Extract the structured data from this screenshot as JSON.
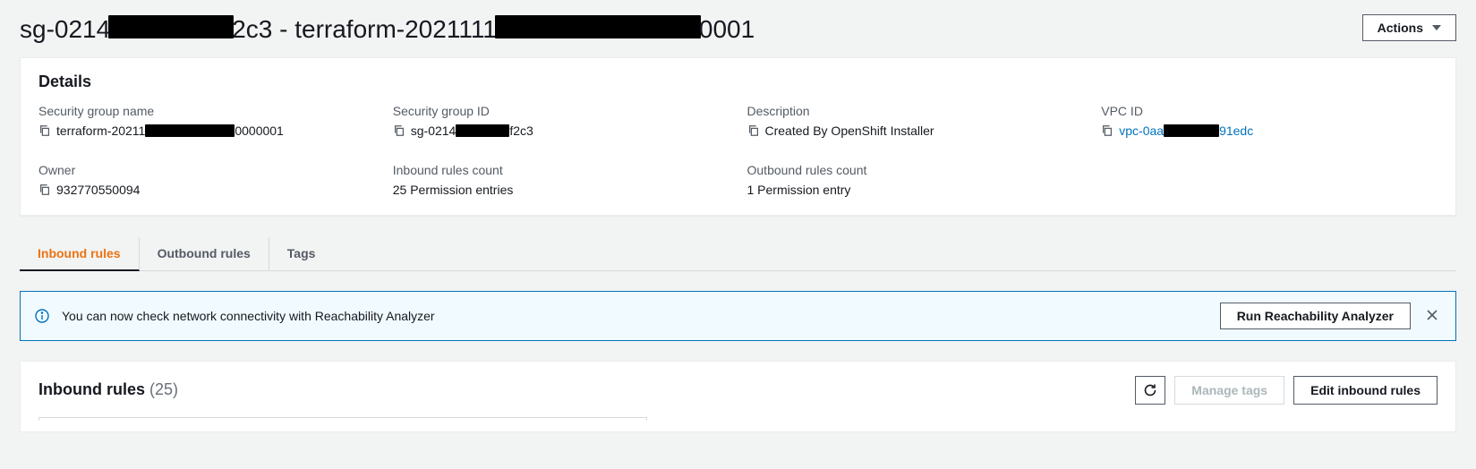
{
  "page": {
    "title_pre": "sg-0214",
    "title_mid": "2c3 - terraform-2021111",
    "title_post": "0001",
    "actions_label": "Actions"
  },
  "details": {
    "header": "Details",
    "fields": {
      "sg_name": {
        "label": "Security group name",
        "value_pre": "terraform-20211",
        "value_post": "0000001"
      },
      "sg_id": {
        "label": "Security group ID",
        "value_pre": "sg-0214",
        "value_post": "f2c3"
      },
      "desc": {
        "label": "Description",
        "value": "Created By OpenShift Installer"
      },
      "vpc": {
        "label": "VPC ID",
        "value_pre": "vpc-0aa",
        "value_post": "91edc"
      },
      "owner": {
        "label": "Owner",
        "value": "932770550094"
      },
      "inbound": {
        "label": "Inbound rules count",
        "value": "25 Permission entries"
      },
      "outbound": {
        "label": "Outbound rules count",
        "value": "1 Permission entry"
      }
    }
  },
  "tabs": {
    "inbound": "Inbound rules",
    "outbound": "Outbound rules",
    "tags": "Tags"
  },
  "banner": {
    "text": "You can now check network connectivity with Reachability Analyzer",
    "button": "Run Reachability Analyzer"
  },
  "rules": {
    "title": "Inbound rules",
    "count": "(25)",
    "manage_tags": "Manage tags",
    "edit": "Edit inbound rules"
  }
}
